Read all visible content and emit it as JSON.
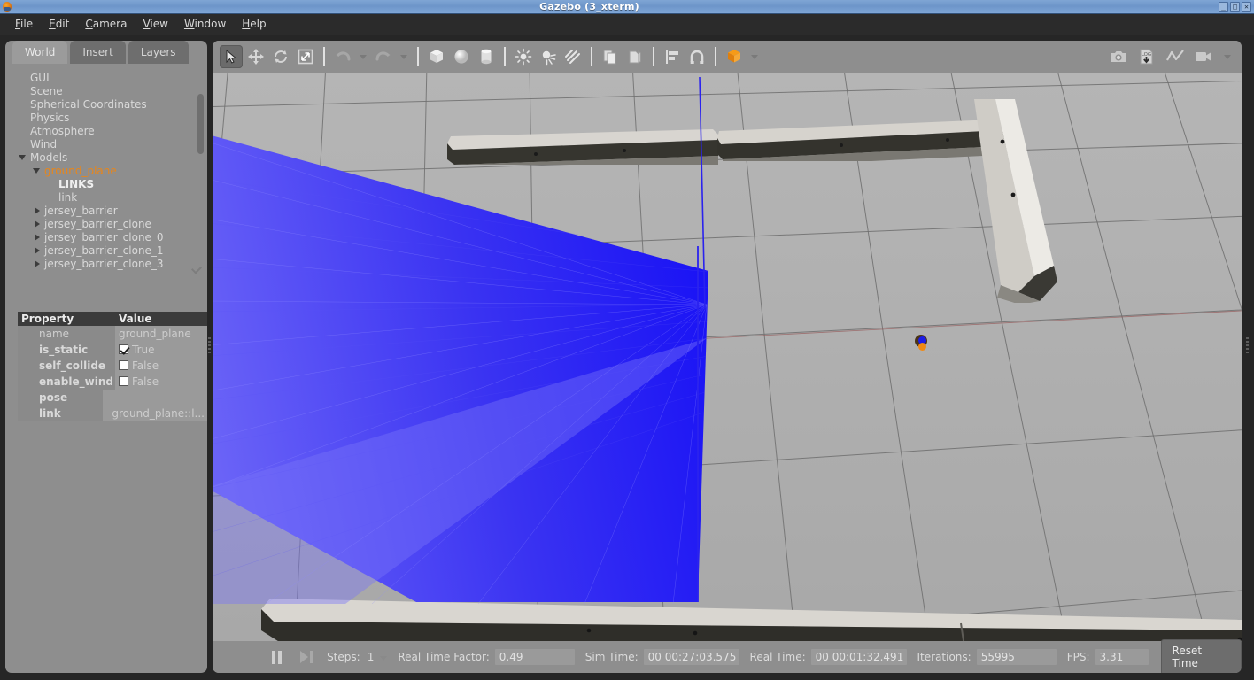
{
  "window": {
    "title": "Gazebo (3_xterm)",
    "app_icon": "gazebo-icon",
    "buttons": {
      "minimize": "_",
      "maximize": "□",
      "close": "✕"
    }
  },
  "menubar": {
    "items": [
      {
        "label": "File",
        "mnemonic": "F"
      },
      {
        "label": "Edit",
        "mnemonic": "E"
      },
      {
        "label": "Camera",
        "mnemonic": "C"
      },
      {
        "label": "View",
        "mnemonic": "V"
      },
      {
        "label": "Window",
        "mnemonic": "W"
      },
      {
        "label": "Help",
        "mnemonic": "H"
      }
    ]
  },
  "left_panel": {
    "tabs": [
      {
        "label": "World",
        "active": true
      },
      {
        "label": "Insert",
        "active": false
      },
      {
        "label": "Layers",
        "active": false
      }
    ],
    "tree": [
      {
        "label": "GUI",
        "indent": 0,
        "caret": "none",
        "style": "normal"
      },
      {
        "label": "Scene",
        "indent": 0,
        "caret": "none",
        "style": "normal"
      },
      {
        "label": "Spherical Coordinates",
        "indent": 0,
        "caret": "none",
        "style": "normal"
      },
      {
        "label": "Physics",
        "indent": 0,
        "caret": "none",
        "style": "normal"
      },
      {
        "label": "Atmosphere",
        "indent": 0,
        "caret": "none",
        "style": "normal"
      },
      {
        "label": "Wind",
        "indent": 0,
        "caret": "none",
        "style": "normal"
      },
      {
        "label": "Models",
        "indent": 0,
        "caret": "down",
        "style": "normal"
      },
      {
        "label": "ground_plane",
        "indent": 1,
        "caret": "down",
        "style": "selected"
      },
      {
        "label": "LINKS",
        "indent": 2,
        "caret": "none",
        "style": "bold"
      },
      {
        "label": "link",
        "indent": 2,
        "caret": "none",
        "style": "normal"
      },
      {
        "label": "jersey_barrier",
        "indent": 1,
        "caret": "right",
        "style": "normal"
      },
      {
        "label": "jersey_barrier_clone",
        "indent": 1,
        "caret": "right",
        "style": "normal"
      },
      {
        "label": "jersey_barrier_clone_0",
        "indent": 1,
        "caret": "right",
        "style": "normal"
      },
      {
        "label": "jersey_barrier_clone_1",
        "indent": 1,
        "caret": "right",
        "style": "normal"
      },
      {
        "label": "jersey_barrier_clone_3",
        "indent": 1,
        "caret": "right",
        "style": "normal"
      }
    ],
    "properties": {
      "header": {
        "property": "Property",
        "value": "Value"
      },
      "rows": [
        {
          "name": "name",
          "value": "ground_plane",
          "kind": "text",
          "bold": false
        },
        {
          "name": "is_static",
          "value": "True",
          "kind": "checkbox",
          "checked": true,
          "bold": true
        },
        {
          "name": "self_collide",
          "value": "False",
          "kind": "checkbox",
          "checked": false,
          "bold": true
        },
        {
          "name": "enable_wind",
          "value": "False",
          "kind": "checkbox",
          "checked": false,
          "bold": true
        },
        {
          "name": "pose",
          "value": "",
          "kind": "expander",
          "bold": true
        },
        {
          "name": "link",
          "value": "ground_plane::l...",
          "kind": "expander",
          "bold": true
        }
      ]
    }
  },
  "toolbar": {
    "left_tools": [
      {
        "name": "select-mode",
        "icon": "cursor-arrow-icon",
        "active": true
      },
      {
        "name": "translate-mode",
        "icon": "move-arrows-icon",
        "active": false
      },
      {
        "name": "rotate-mode",
        "icon": "rotate-icon",
        "active": false
      },
      {
        "name": "scale-mode",
        "icon": "scale-icon",
        "active": false
      },
      {
        "name": "undo",
        "icon": "undo-arrow-icon",
        "active": false
      },
      {
        "name": "undo-menu",
        "icon": "chevron-down-icon",
        "active": false
      },
      {
        "name": "redo",
        "icon": "redo-arrow-icon",
        "active": false
      },
      {
        "name": "redo-menu",
        "icon": "chevron-down-icon",
        "active": false
      },
      {
        "name": "insert-box",
        "icon": "cube-icon",
        "active": false
      },
      {
        "name": "insert-sphere",
        "icon": "sphere-icon",
        "active": false
      },
      {
        "name": "insert-cylinder",
        "icon": "cylinder-icon",
        "active": false
      },
      {
        "name": "point-light",
        "icon": "point-light-icon",
        "active": false
      },
      {
        "name": "spot-light",
        "icon": "spot-light-icon",
        "active": false
      },
      {
        "name": "directional-light",
        "icon": "directional-light-icon",
        "active": false
      },
      {
        "name": "copy",
        "icon": "copy-icon",
        "active": false
      },
      {
        "name": "paste",
        "icon": "paste-icon",
        "active": false
      },
      {
        "name": "align",
        "icon": "align-icon",
        "active": false
      },
      {
        "name": "snap",
        "icon": "magnet-icon",
        "active": false
      },
      {
        "name": "view-angle",
        "icon": "orange-cube-icon",
        "active": false
      }
    ],
    "right_tools": [
      {
        "name": "screenshot",
        "icon": "camera-icon"
      },
      {
        "name": "log-record",
        "icon": "log-download-icon"
      },
      {
        "name": "plot",
        "icon": "line-chart-icon"
      },
      {
        "name": "video-record",
        "icon": "video-camera-icon"
      }
    ]
  },
  "statusbar": {
    "pause_icon": "pause-icon",
    "step_icon": "step-forward-icon",
    "steps_label": "Steps:",
    "steps_value": "1",
    "rtf_label": "Real Time Factor:",
    "rtf_value": "0.49",
    "sim_time_label": "Sim Time:",
    "sim_time_value": "00 00:27:03.575",
    "real_time_label": "Real Time:",
    "real_time_value": "00 00:01:32.491",
    "iterations_label": "Iterations:",
    "iterations_value": "55995",
    "fps_label": "FPS:",
    "fps_value": "3.31",
    "reset_label": "Reset Time"
  },
  "scene": {
    "description": "Gazebo 3D viewport showing a ground plane grid with jersey barriers and a blue laser scan fan emitted from a sensor",
    "laser_color": "#3a35f0",
    "ground_color": "#b0b0b0",
    "grid_color": "#6a6a6a",
    "sensor_marker": "laser-sensor-marker"
  }
}
